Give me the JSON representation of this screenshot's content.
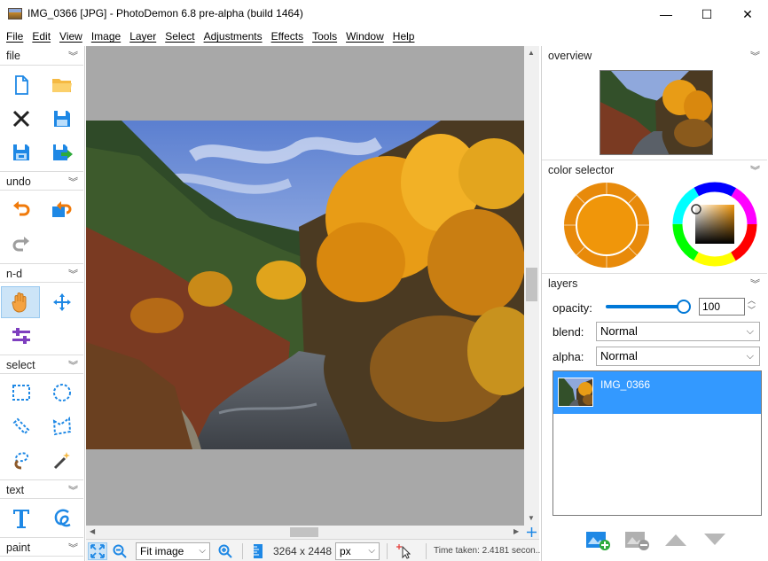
{
  "window": {
    "title": "IMG_0366 [JPG]  -  PhotoDemon 6.8 pre-alpha (build 1464)",
    "minimize_glyph": "—",
    "maximize_glyph": "☐",
    "close_glyph": "✕"
  },
  "menu": [
    "File",
    "Edit",
    "View",
    "Image",
    "Layer",
    "Select",
    "Adjustments",
    "Effects",
    "Tools",
    "Window",
    "Help"
  ],
  "toolbox": {
    "sections": {
      "file": "file",
      "undo": "undo",
      "nd": "n-d",
      "select": "select",
      "text": "text",
      "paint": "paint"
    },
    "chevron": "︾"
  },
  "canvas": {
    "background": "#a8a8a8"
  },
  "statusbar": {
    "zoom_mode": "Fit image",
    "image_size": "3264 x 2448",
    "unit": "px",
    "time_taken": "Time taken: 2.4181 secon..."
  },
  "right_panel": {
    "overview_title": "overview",
    "color_selector_title": "color selector",
    "layers_title": "layers",
    "opacity_label": "opacity:",
    "opacity_value": "100",
    "opacity_fraction": 1.0,
    "blend_label": "blend:",
    "blend_value": "Normal",
    "alpha_label": "alpha:",
    "alpha_value": "Normal",
    "layer_name": "IMG_0366",
    "primary_color": "#f0960a",
    "accent_color": "#0078d7",
    "selection_color": "#3399ff"
  }
}
